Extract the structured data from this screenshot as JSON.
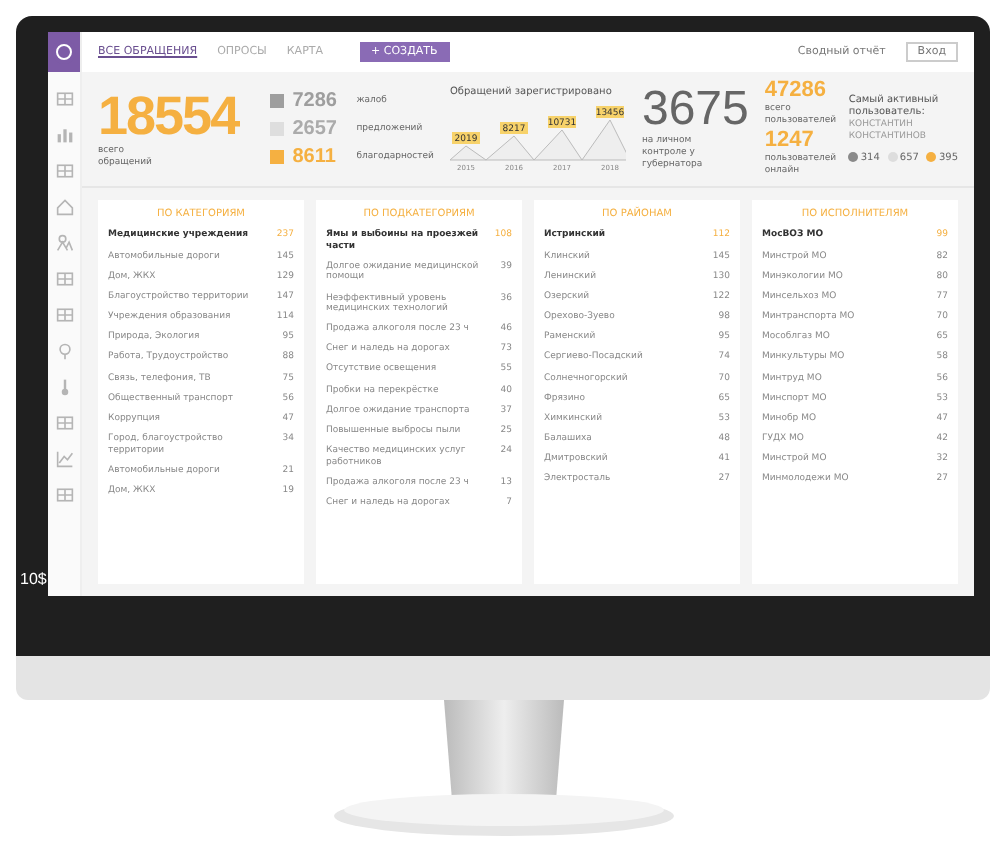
{
  "header": {
    "tabs": [
      {
        "label": "ВСЕ ОБРАЩЕНИЯ",
        "selected": true
      },
      {
        "label": "ОПРОСЫ",
        "selected": false
      },
      {
        "label": "КАРТА",
        "selected": false
      }
    ],
    "create_button": "+ СОЗДАТЬ",
    "report_link": "Сводный отчёт",
    "login_button": "Вход"
  },
  "summary": {
    "total": "18554",
    "total_label": "всего обращений",
    "legend": [
      {
        "value": "7286",
        "label": "жалоб",
        "color": "#9e9e9e"
      },
      {
        "value": "2657",
        "label": "предложений",
        "color": "#dedede"
      },
      {
        "value": "8611",
        "label": "благодарностей",
        "color": "#f5b041"
      }
    ]
  },
  "trend": {
    "title": "Обращений зарегистрировано",
    "peak_labels": [
      "2019",
      "8217",
      "10731",
      "13456"
    ],
    "axis_labels": [
      "2015",
      "2016",
      "2017",
      "2018"
    ]
  },
  "control": {
    "value": "3675",
    "label": "на личном контроле у губернатора"
  },
  "users": {
    "total": "47286",
    "total_label": "всего пользователей",
    "online": "1247",
    "online_label": "пользователей онлайн"
  },
  "active_user": {
    "title": "Самый активный пользователь:",
    "name": "КОНСТАНТИН КОНСТАНТИНОВ",
    "stats": [
      {
        "value": "314",
        "color": "#8a8a8a"
      },
      {
        "value": "657",
        "color": "#dddddd"
      },
      {
        "value": "395",
        "color": "#f5b041"
      }
    ]
  },
  "cards": [
    {
      "title": "ПО КАТЕГОРИЯМ",
      "rows": [
        {
          "name": "Медицинские учреждения",
          "value": "237",
          "highlighted": true
        },
        {
          "name": "Автомобильные дороги",
          "value": "145",
          "highlighted": false
        },
        {
          "name": "Дом, ЖКХ",
          "value": "129",
          "highlighted": false
        },
        {
          "name": "Благоустройство территории",
          "value": "147",
          "highlighted": false
        },
        {
          "name": "Учреждения образования",
          "value": "114",
          "highlighted": false
        },
        {
          "name": "Природа, Экология",
          "value": "95",
          "highlighted": false
        },
        {
          "name": "Работа, Трудоустройство",
          "value": "88",
          "highlighted": false
        },
        {
          "name": "Связь, телефония, ТВ",
          "value": "75",
          "highlighted": false
        },
        {
          "name": "Общественный транспорт",
          "value": "56",
          "highlighted": false
        },
        {
          "name": "Коррупция",
          "value": "47",
          "highlighted": false
        },
        {
          "name": "Город, благоустройство территории",
          "value": "34",
          "highlighted": false
        },
        {
          "name": "Автомобильные дороги",
          "value": "21",
          "highlighted": false
        },
        {
          "name": "Дом, ЖКХ",
          "value": "19",
          "highlighted": false
        }
      ]
    },
    {
      "title": "ПО ПОДКАТЕГОРИЯМ",
      "rows": [
        {
          "name": "Ямы и выбоины на проезжей части",
          "value": "108",
          "highlighted": true
        },
        {
          "name": "Долгое ожидание медицинской помощи",
          "value": "39",
          "highlighted": false
        },
        {
          "name": "Неэффективный уровень медицинских технологий",
          "value": "36",
          "highlighted": false
        },
        {
          "name": "Продажа алкоголя после 23 ч",
          "value": "46",
          "highlighted": false
        },
        {
          "name": "Снег и наледь на дорогах",
          "value": "73",
          "highlighted": false
        },
        {
          "name": "Отсутствие освещения",
          "value": "55",
          "highlighted": false
        },
        {
          "name": "Пробки на перекрёстке",
          "value": "40",
          "highlighted": false
        },
        {
          "name": "Долгое ожидание транспорта",
          "value": "37",
          "highlighted": false
        },
        {
          "name": "Повышенные выбросы пыли",
          "value": "25",
          "highlighted": false
        },
        {
          "name": "Качество медицинских услуг работников",
          "value": "24",
          "highlighted": false
        },
        {
          "name": "Продажа алкоголя после 23 ч",
          "value": "13",
          "highlighted": false
        },
        {
          "name": "Снег и наледь на дорогах",
          "value": "7",
          "highlighted": false
        }
      ]
    },
    {
      "title": "ПО РАЙОНАМ",
      "rows": [
        {
          "name": "Истринский",
          "value": "112",
          "highlighted": true
        },
        {
          "name": "Клинский",
          "value": "145",
          "highlighted": false
        },
        {
          "name": "Ленинский",
          "value": "130",
          "highlighted": false
        },
        {
          "name": "Озерский",
          "value": "122",
          "highlighted": false
        },
        {
          "name": "Орехово-Зуево",
          "value": "98",
          "highlighted": false
        },
        {
          "name": "Раменский",
          "value": "95",
          "highlighted": false
        },
        {
          "name": "Сергиево-Посадский",
          "value": "74",
          "highlighted": false
        },
        {
          "name": "Солнечногорский",
          "value": "70",
          "highlighted": false
        },
        {
          "name": "Фрязино",
          "value": "65",
          "highlighted": false
        },
        {
          "name": "Химкинский",
          "value": "53",
          "highlighted": false
        },
        {
          "name": "Балашиха",
          "value": "48",
          "highlighted": false
        },
        {
          "name": "Дмитровский",
          "value": "41",
          "highlighted": false
        },
        {
          "name": "Электросталь",
          "value": "27",
          "highlighted": false
        }
      ]
    },
    {
      "title": "ПО ИСПОЛНИТЕЛЯМ",
      "rows": [
        {
          "name": "МосВОЗ МО",
          "value": "99",
          "highlighted": true
        },
        {
          "name": "Минстрой МО",
          "value": "82",
          "highlighted": false
        },
        {
          "name": "Минэкологии МО",
          "value": "80",
          "highlighted": false
        },
        {
          "name": "Минсельхоз МО",
          "value": "77",
          "highlighted": false
        },
        {
          "name": "Минтранспорта МО",
          "value": "70",
          "highlighted": false
        },
        {
          "name": "Мособлгаз МО",
          "value": "65",
          "highlighted": false
        },
        {
          "name": "Минкультуры МО",
          "value": "58",
          "highlighted": false
        },
        {
          "name": "Минтруд МО",
          "value": "56",
          "highlighted": false
        },
        {
          "name": "Минспорт МО",
          "value": "53",
          "highlighted": false
        },
        {
          "name": "Минобр МО",
          "value": "47",
          "highlighted": false
        },
        {
          "name": "ГУДХ МО",
          "value": "42",
          "highlighted": false
        },
        {
          "name": "Минстрой МО",
          "value": "32",
          "highlighted": false
        },
        {
          "name": "Минмолодежи МО",
          "value": "27",
          "highlighted": false
        }
      ]
    }
  ],
  "corner_text": "10$"
}
